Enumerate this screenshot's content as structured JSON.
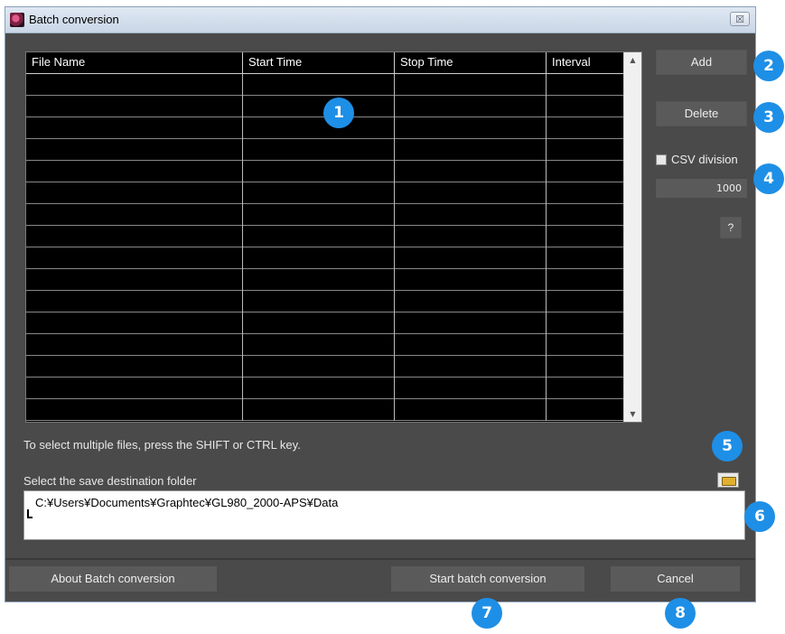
{
  "window": {
    "title": "Batch conversion",
    "close_glyph": "☒"
  },
  "file_table": {
    "columns": [
      "File Name",
      "Start Time",
      "Stop Time",
      "Interval"
    ],
    "rows": [],
    "scroll_up_glyph": "▲",
    "scroll_down_glyph": "▼"
  },
  "side_panel": {
    "add_label": "Add",
    "delete_label": "Delete",
    "csv_division_label": "CSV division",
    "csv_division_checked": false,
    "csv_division_value": "1000",
    "help_label": "?"
  },
  "hint_text": "To select multiple files, press the SHIFT or CTRL key.",
  "save_folder": {
    "label": "Select the save destination folder",
    "path": "C:¥Users¥Documents¥Graphtec¥GL980_2000-APS¥Data",
    "browse_icon": "folder-open-icon"
  },
  "footer": {
    "about_label": "About Batch conversion",
    "start_label": "Start batch conversion",
    "cancel_label": "Cancel"
  },
  "callouts": [
    "1",
    "2",
    "3",
    "4",
    "5",
    "6",
    "7",
    "8"
  ],
  "colors": {
    "window_bg": "#4a4a4a",
    "button_bg": "#5a5a5a",
    "callout_blue": "#1e8fe6"
  }
}
